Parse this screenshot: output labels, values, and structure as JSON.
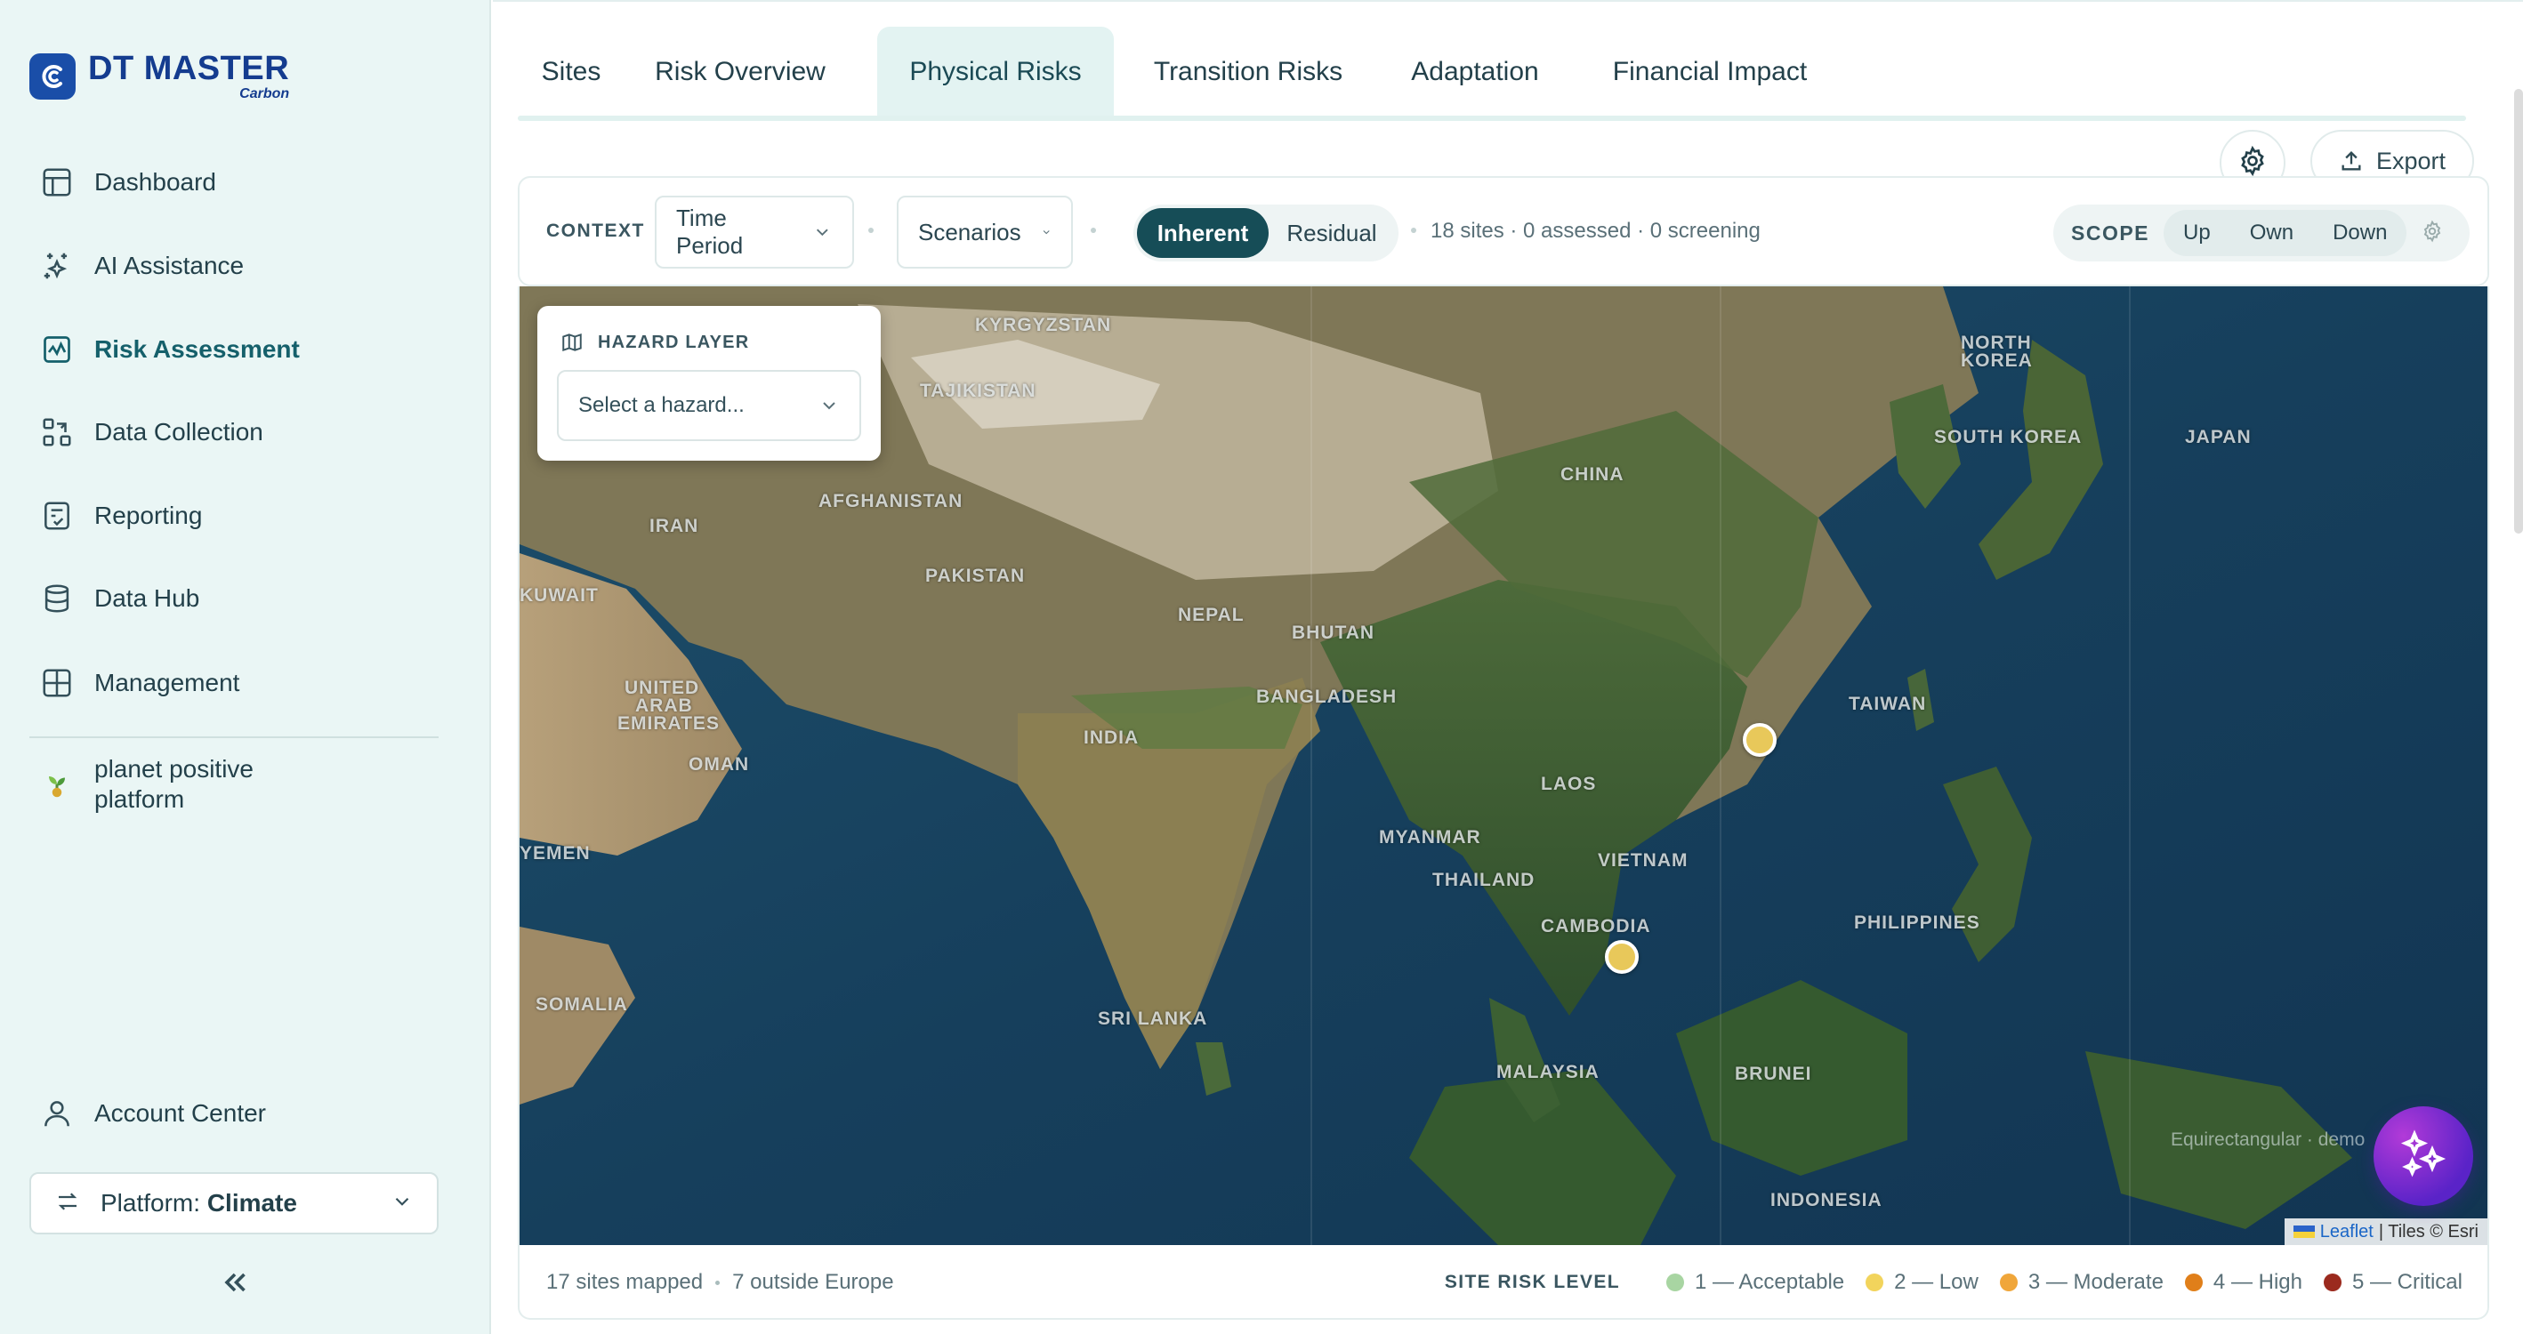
{
  "brand": {
    "title": "DT MASTER",
    "subtitle": "Carbon",
    "color": "#143c8f"
  },
  "sidebar": {
    "items": [
      {
        "label": "Dashboard",
        "icon": "layout-icon"
      },
      {
        "label": "AI Assistance",
        "icon": "sparkles-icon"
      },
      {
        "label": "Risk Assessment",
        "icon": "activity-icon",
        "active": true
      },
      {
        "label": "Data Collection",
        "icon": "data-collection-icon"
      },
      {
        "label": "Reporting",
        "icon": "report-check-icon"
      },
      {
        "label": "Data Hub",
        "icon": "database-icon"
      },
      {
        "label": "Management",
        "icon": "grid-icon"
      }
    ],
    "partner": {
      "line1": "planet positive",
      "line2": "platform",
      "icon": "sprout-icon"
    },
    "account": {
      "label": "Account Center",
      "icon": "user-icon"
    },
    "platform": {
      "prefix": "Platform: ",
      "value": "Climate"
    }
  },
  "tabs": [
    {
      "label": "Sites"
    },
    {
      "label": "Risk Overview"
    },
    {
      "label": "Physical Risks",
      "active": true
    },
    {
      "label": "Transition Risks"
    },
    {
      "label": "Adaptation"
    },
    {
      "label": "Financial Impact"
    }
  ],
  "toolbar": {
    "export_label": "Export"
  },
  "context": {
    "label": "CONTEXT",
    "time_period": "Time Period",
    "scenarios": "Scenarios",
    "toggle": {
      "on": "Inherent",
      "off": "Residual"
    },
    "summary": "18 sites · 0 assessed · 0 screening",
    "scope": {
      "label": "SCOPE",
      "options": [
        "Up",
        "Own",
        "Down"
      ]
    }
  },
  "hazard": {
    "title": "HAZARD LAYER",
    "placeholder": "Select a hazard..."
  },
  "map": {
    "countries": [
      "KYRGYZSTAN",
      "TAJIKISTAN",
      "NORTH",
      "KOREA",
      "SOUTH KOREA",
      "JAPAN",
      "CHINA",
      "AFGHANISTAN",
      "IRAN",
      "PAKISTAN",
      "NEPAL",
      "BHUTAN",
      "KUWAIT",
      "UNITED",
      "ARAB",
      "EMIRATES",
      "OMAN",
      "BANGLADESH",
      "INDIA",
      "TAIWAN",
      "LAOS",
      "MYANMAR",
      "THAILAND",
      "VIETNAM",
      "YEMEN",
      "CAMBODIA",
      "PHILIPPINES",
      "SOMALIA",
      "SRI LANKA",
      "MALAYSIA",
      "BRUNEI",
      "INDONESIA"
    ],
    "projection_note": "Equirectangular · demo",
    "attribution": {
      "leaflet": "Leaflet",
      "tiles": "| Tiles © Esri"
    }
  },
  "footer": {
    "mapped": "17 sites mapped",
    "outside": "7 outside Europe",
    "legend_title": "SITE RISK LEVEL",
    "levels": [
      {
        "label": "1 — Acceptable",
        "color": "#a8d5a2"
      },
      {
        "label": "2 — Low",
        "color": "#f2d45c"
      },
      {
        "label": "3 — Moderate",
        "color": "#f0a63a"
      },
      {
        "label": "4 — High",
        "color": "#e07f1a"
      },
      {
        "label": "5 — Critical",
        "color": "#9b2a1e"
      }
    ]
  },
  "colors": {
    "accent": "#164d57",
    "sidebar_bg": "#eaf6f5",
    "marker": "#e8c85a"
  }
}
